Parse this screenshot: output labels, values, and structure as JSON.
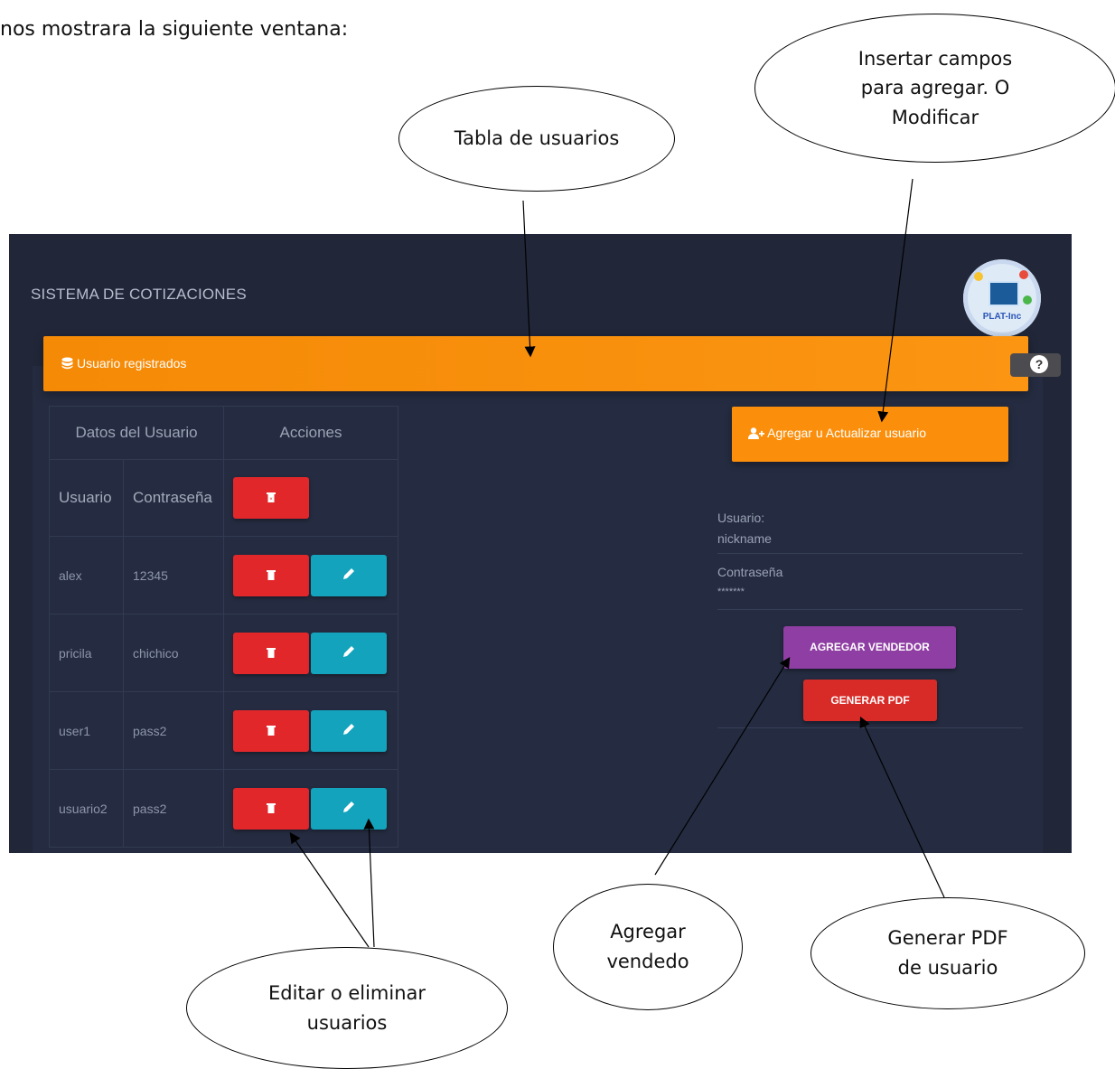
{
  "intro_text": "nos mostrara la siguiente ventana:",
  "app": {
    "title": "SISTEMA DE COTIZACIONES",
    "logo_text": "PLAT-Inc",
    "help_icon": "?",
    "header": {
      "label": "Usuario registrados",
      "icon": "database-icon",
      "color": "#f58a06"
    },
    "table": {
      "header_left": "Datos del Usuario",
      "header_right": "Acciones",
      "sub_user": "Usuario",
      "sub_pass": "Contraseña",
      "rows": [
        {
          "user": "alex",
          "pass": "12345"
        },
        {
          "user": "pricila",
          "pass": "chichico"
        },
        {
          "user": "user1",
          "pass": "pass2"
        },
        {
          "user": "usuario2",
          "pass": "pass2"
        }
      ]
    },
    "form": {
      "title": "Agregar u Actualizar usuario",
      "user_label": "Usuario:",
      "user_placeholder": "nickname",
      "pass_label": "Contraseña",
      "pass_placeholder": "*******",
      "add_button": "AGREGAR VENDEDOR",
      "pdf_button": "GENERAR PDF"
    },
    "colors": {
      "delete": "#e2272b",
      "edit": "#13a3bc",
      "add": "#8f3ea3",
      "pdf": "#d82b27"
    }
  },
  "annotations": {
    "tabla": "Tabla de usuarios",
    "insertar": "Insertar campos para agregar. O Modificar",
    "editar": "Editar o eliminar usuarios",
    "agregar": "Agregar vendedo",
    "pdf": "Generar PDF de usuario"
  }
}
